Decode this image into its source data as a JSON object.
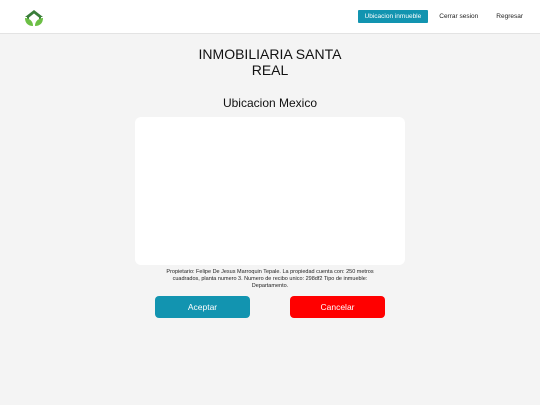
{
  "navbar": {
    "logo_icon": "house-leaf-logo-icon",
    "links": [
      {
        "label": "Ubicacion inmueble",
        "active": true
      },
      {
        "label": "Cerrar sesion",
        "active": false
      },
      {
        "label": "Regresar",
        "active": false
      }
    ],
    "accent_color": "#1294b0"
  },
  "main": {
    "title_line1": "INMOBILIARIA SANTA",
    "title_line2": "REAL",
    "subtitle": "Ubicacion Mexico",
    "description": "Propietario: Felipe De Jesus Marroquin Tepale. La propiedad cuenta con: 250 metros cuadrados, planta numero 3. Numero de recibo unico: 298df2 Tipo de inmueble: Departamento.",
    "buttons": {
      "accept_label": "Aceptar",
      "cancel_label": "Cancelar",
      "accept_color": "#1294b0",
      "cancel_color": "#ff0000"
    }
  }
}
